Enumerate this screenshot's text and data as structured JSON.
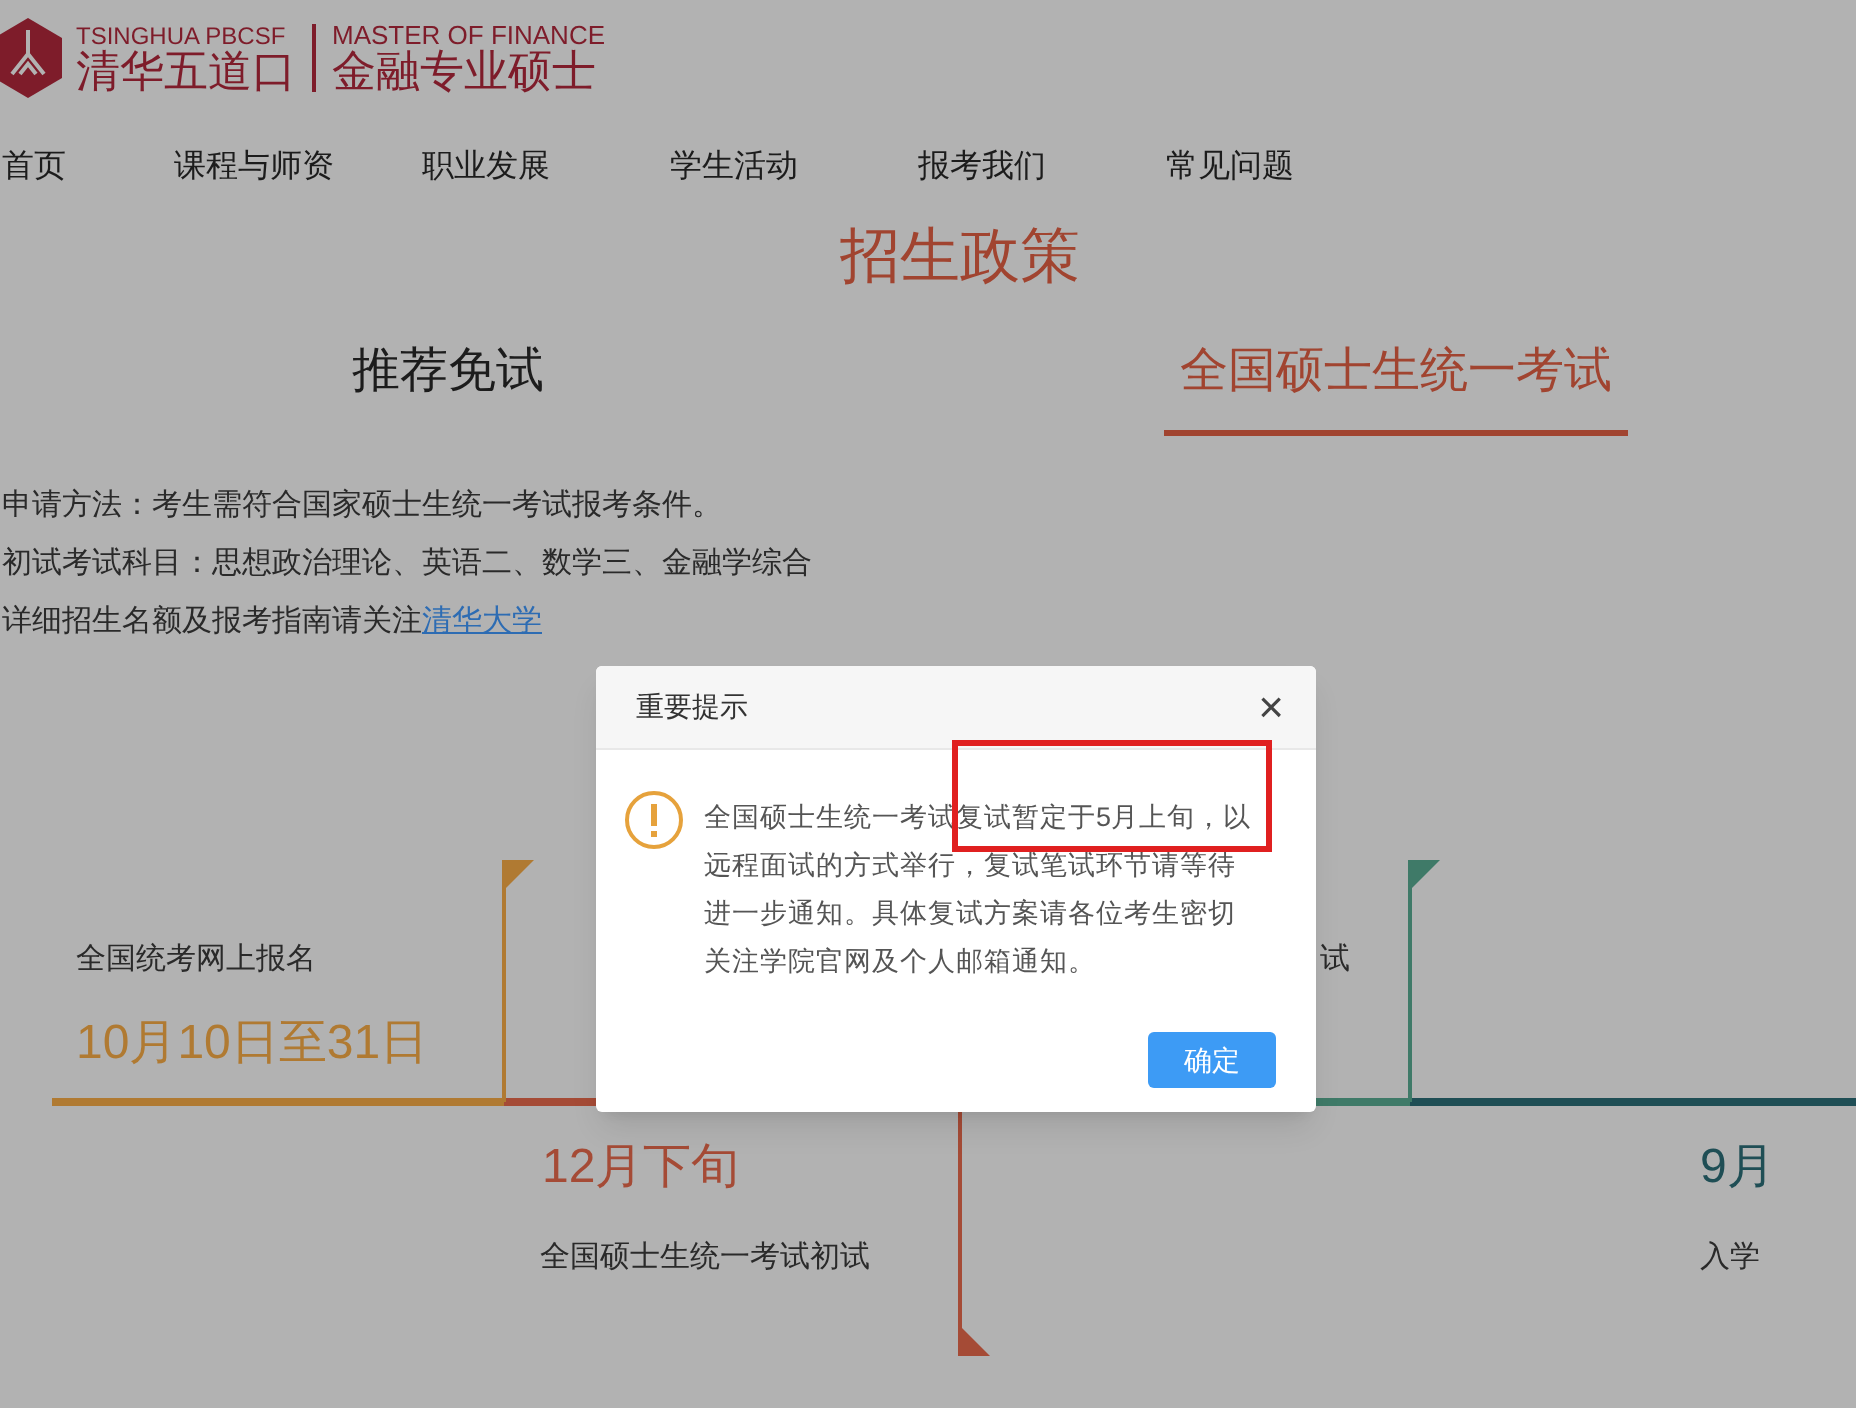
{
  "logo": {
    "en_left": "TSINGHUA PBCSF",
    "cn_left": "清华五道口",
    "en_right": "MASTER OF FINANCE",
    "cn_right": "金融专业硕士"
  },
  "nav": [
    "首页",
    "课程与师资",
    "职业发展",
    "学生活动",
    "报考我们",
    "常见问题"
  ],
  "section_title": "招生政策",
  "tabs": [
    {
      "label": "推荐免试",
      "selected": false
    },
    {
      "label": "全国硕士生统一考试",
      "selected": true
    }
  ],
  "info_lines": [
    {
      "text": "申请方法：考生需符合国家硕士生统一考试报考条件。"
    },
    {
      "text": "初试考试科目：思想政治理论、英语二、数学三、金融学综合"
    },
    {
      "text": "详细招生名额及报考指南请关注",
      "link": "清华大学"
    }
  ],
  "timeline": [
    {
      "date": "10月10日至31日",
      "label": "全国统考网上报名",
      "color": "#b07a32",
      "kind": "up"
    },
    {
      "date": "12月下旬",
      "label": "全国硕士生统一考试初试",
      "color": "#a54b36",
      "kind": "down"
    },
    {
      "label": "试",
      "color": "#3f7a68",
      "kind": "up"
    },
    {
      "date": "9月",
      "label": "入学",
      "color": "#1f4e55",
      "kind": "end"
    }
  ],
  "dialog": {
    "title": "重要提示",
    "close": "×",
    "message": "全国硕士生统一考试复试暂定于5月上旬，以远程面试的方式举行，复试笔试环节请等待进一步通知。具体复试方案请各位考生密切关注学院官网及个人邮箱通知。",
    "confirm": "确定"
  },
  "annotation": {
    "kind": "highlight",
    "color": "#e02020"
  }
}
